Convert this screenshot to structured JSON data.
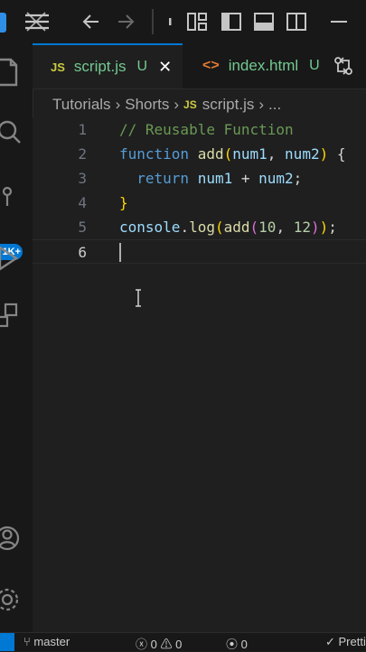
{
  "titlebar": {
    "icons": [
      "menu-icon",
      "back-arrow-icon",
      "forward-arrow-icon",
      "layout-panels-icon",
      "toggle-sidebar-icon",
      "toggle-panel-icon",
      "toggle-secondary-sidebar-icon"
    ]
  },
  "activity": {
    "items": [
      "explorer-icon",
      "search-icon",
      "source-control-icon",
      "run-debug-icon",
      "extensions-icon",
      "accounts-icon",
      "settings-gear-icon"
    ],
    "badge": "1K+"
  },
  "tabs": [
    {
      "label": "script.js",
      "icon": "JS",
      "status": "U",
      "active": true
    },
    {
      "label": "index.html",
      "icon": "<>",
      "status": "U",
      "active": false
    }
  ],
  "breadcrumb": {
    "folder1": "Tutorials",
    "folder2": "Shorts",
    "file_icon": "JS",
    "file": "script.js",
    "more": "..."
  },
  "editor": {
    "lines": [
      {
        "num": "1",
        "tokens": [
          [
            "comment",
            "// Reusable Function"
          ]
        ]
      },
      {
        "num": "2",
        "tokens": [
          [
            "keyword",
            "function"
          ],
          [
            "punct",
            " "
          ],
          [
            "func",
            "add"
          ],
          [
            "brace",
            "("
          ],
          [
            "param",
            "num1"
          ],
          [
            "punct",
            ", "
          ],
          [
            "param",
            "num2"
          ],
          [
            "brace",
            ")"
          ],
          [
            "punct",
            " {"
          ]
        ]
      },
      {
        "num": "3",
        "tokens": [
          [
            "punct",
            "  "
          ],
          [
            "keyword",
            "return"
          ],
          [
            "punct",
            " "
          ],
          [
            "param",
            "num1"
          ],
          [
            "punct",
            " + "
          ],
          [
            "param",
            "num2"
          ],
          [
            "punct",
            ";"
          ]
        ]
      },
      {
        "num": "4",
        "tokens": [
          [
            "brace",
            "}"
          ]
        ]
      },
      {
        "num": "5",
        "tokens": [
          [
            "var",
            "console"
          ],
          [
            "punct",
            "."
          ],
          [
            "func",
            "log"
          ],
          [
            "brace",
            "("
          ],
          [
            "func",
            "add"
          ],
          [
            "paren2",
            "("
          ],
          [
            "num",
            "10"
          ],
          [
            "punct",
            ", "
          ],
          [
            "num",
            "12"
          ],
          [
            "paren2",
            ")"
          ],
          [
            "brace",
            ")"
          ],
          [
            "punct",
            ";"
          ]
        ]
      },
      {
        "num": "6",
        "tokens": []
      }
    ],
    "active_line": "6"
  },
  "statusbar": {
    "branch": "master",
    "errors": "0",
    "warnings": "0",
    "ports": "0",
    "formatter": "Prettier"
  },
  "colors": {
    "accent": "#0078d4",
    "modified": "#73c991",
    "js_badge": "#cbcb41",
    "html_icon": "#e37933"
  }
}
